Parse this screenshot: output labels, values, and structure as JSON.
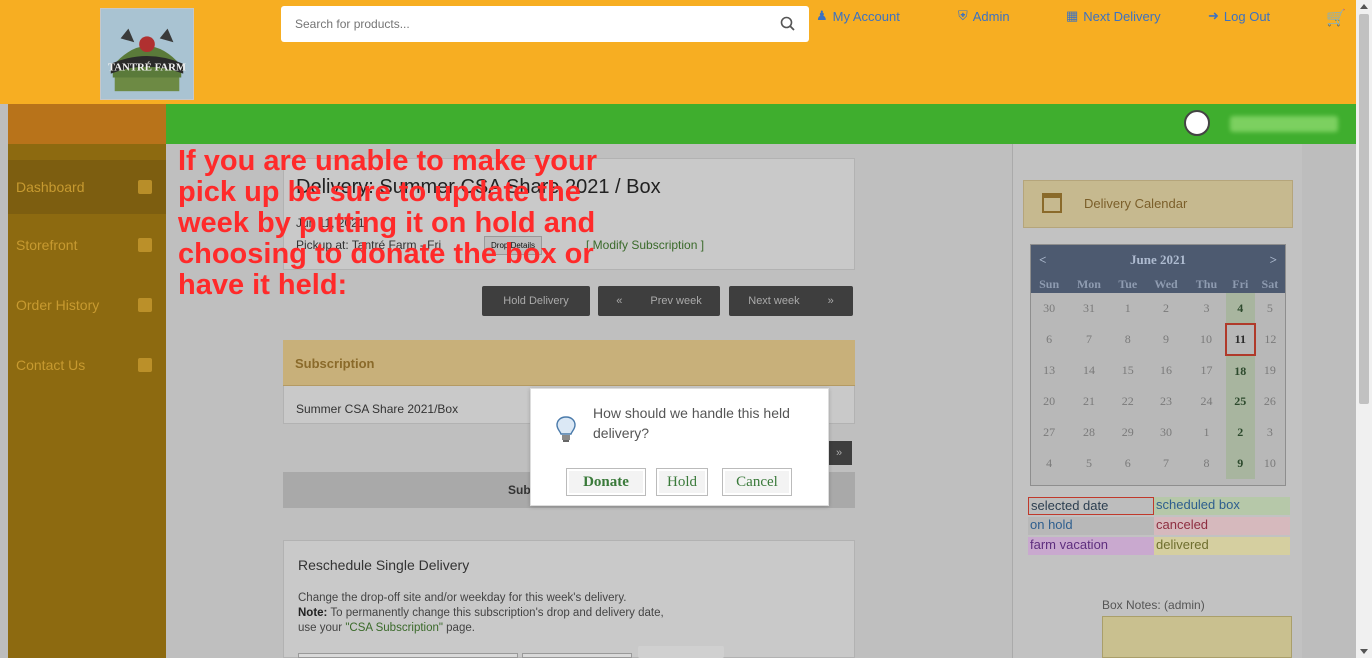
{
  "header": {
    "logo_text": "TANTRÉ FARM",
    "search_placeholder": "Search for products...",
    "nav": [
      {
        "label": "My Account",
        "icon": "user-icon"
      },
      {
        "label": "Admin",
        "icon": "shield-icon"
      },
      {
        "label": "Next Delivery",
        "icon": "calendar-icon"
      },
      {
        "label": "Log Out",
        "icon": "logout-icon"
      }
    ],
    "cart_icon": "cart-icon"
  },
  "sidebar": {
    "items": [
      {
        "label": "Dashboard",
        "icon": "monitor-icon"
      },
      {
        "label": "Storefront",
        "icon": "store-icon"
      },
      {
        "label": "Order History",
        "icon": "history-icon"
      },
      {
        "label": "Contact Us",
        "icon": "chat-icon"
      }
    ]
  },
  "delivery": {
    "title": "Delivery: Summer CSA Share 2021 / Box",
    "date": "Jun 11, 2021",
    "pickup": "Pickup at: Tantré Farm - Fri",
    "drop_details_label": "Drop Details",
    "modify_link": "[ Modify Subscription ]",
    "buttons": {
      "hold_delivery": "Hold Delivery",
      "prev_week": "Prev week",
      "next_week": "Next week",
      "prev_arrow": "«",
      "next_arrow": "»"
    }
  },
  "subscription": {
    "heading": "Subscription",
    "row": "Summer CSA Share 2021/Box",
    "bar_label": "Sub"
  },
  "reschedule": {
    "title": "Reschedule Single Delivery",
    "line1": "Change the drop-off site and/or weekday for this week's delivery.",
    "note_label": "Note:",
    "note_text": " To permanently change this subscription's drop and delivery date,",
    "line3_prefix": "use your ",
    "line3_link": "\"CSA Subscription\"",
    "line3_suffix": " page."
  },
  "overlay": {
    "text": "If you are unable to make your pick up be sure to update the week by putting it on hold and choosing to donate the box or have it held:"
  },
  "dialog": {
    "message": "How should we handle this held delivery?",
    "donate": "Donate",
    "hold": "Hold",
    "cancel": "Cancel"
  },
  "calendar_card": {
    "label": "Delivery Calendar"
  },
  "calendar": {
    "month": "June 2021",
    "prev": "<",
    "next": ">",
    "weekdays": [
      "Sun",
      "Mon",
      "Tue",
      "Wed",
      "Thu",
      "Fri",
      "Sat"
    ],
    "weeks": [
      [
        "30",
        "31",
        "1",
        "2",
        "3",
        "4",
        "5"
      ],
      [
        "6",
        "7",
        "8",
        "9",
        "10",
        "11",
        "12"
      ],
      [
        "13",
        "14",
        "15",
        "16",
        "17",
        "18",
        "19"
      ],
      [
        "20",
        "21",
        "22",
        "23",
        "24",
        "25",
        "26"
      ],
      [
        "27",
        "28",
        "29",
        "30",
        "1",
        "2",
        "3"
      ],
      [
        "4",
        "5",
        "6",
        "7",
        "8",
        "9",
        "10"
      ]
    ],
    "selected": "11"
  },
  "legend": {
    "selected_date": "selected date",
    "scheduled_box": "scheduled box",
    "on_hold": "on hold",
    "canceled": "canceled",
    "farm_vacation": "farm vacation",
    "delivered": "delivered"
  },
  "box_notes": {
    "label": "Box Notes: (admin)"
  },
  "colors": {
    "header_bg": "#f7ae22",
    "green_bar": "#3fae2e",
    "link_blue": "#3c72c2",
    "overlay_red": "#ff2a2a",
    "button_green_text": "#3a7a3a"
  }
}
